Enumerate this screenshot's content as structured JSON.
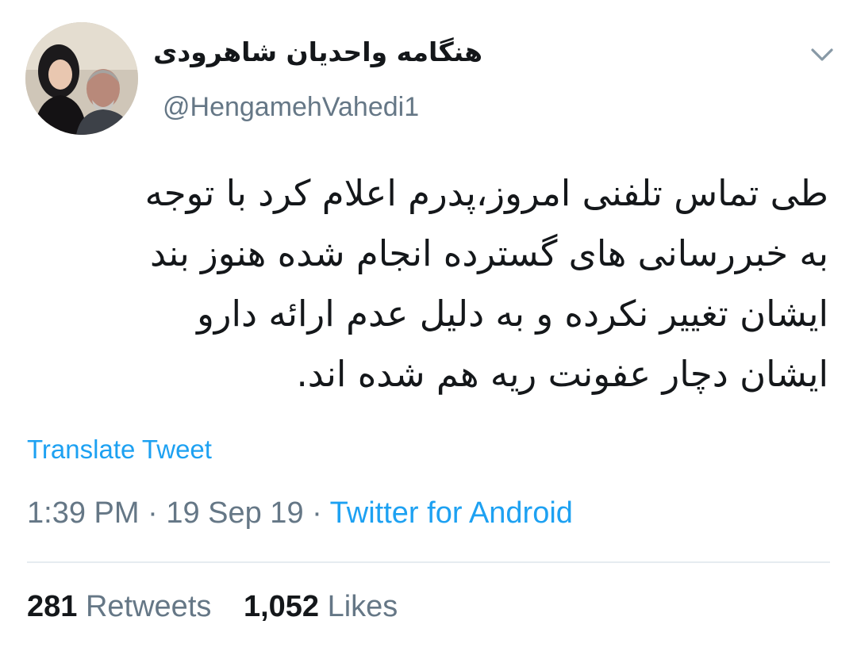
{
  "tweet": {
    "display_name": "هنگامه واحدیان شاهرودی",
    "handle": "@HengamehVahedi1",
    "text_lines": [
      "طی تماس تلفنی امروز،پدرم اعلام کرد با توجه",
      "به خبررسانی های گسترده انجام شده هنوز بند",
      "ایشان تغییر نکرده و به دلیل عدم ارائه دارو",
      "ایشان دچار عفونت ریه هم شده اند."
    ],
    "translate_label": "Translate Tweet",
    "time": "1:39 PM",
    "date": "19 Sep 19",
    "separator": "·",
    "source": "Twitter for Android",
    "retweets_count": "281",
    "retweets_label": "Retweets",
    "likes_count": "1,052",
    "likes_label": "Likes"
  },
  "icons": {
    "menu": "chevron-down-icon",
    "avatar": "profile-photo"
  },
  "colors": {
    "link": "#1da1f2",
    "secondary_text": "#657786",
    "primary_text": "#14171a",
    "divider": "#e6ecf0"
  }
}
